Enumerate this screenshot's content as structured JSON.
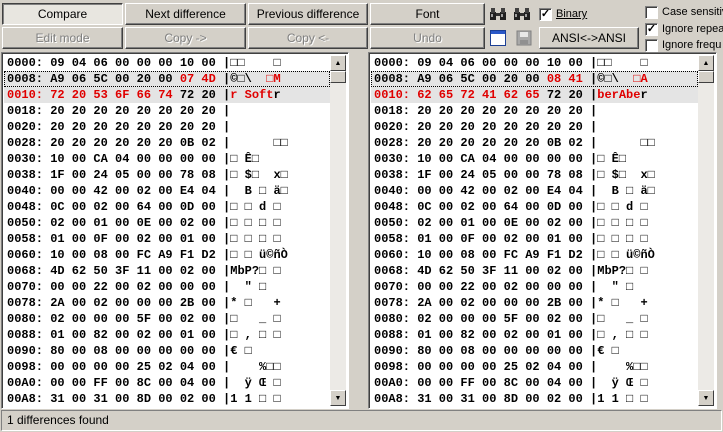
{
  "toolbar": {
    "compare": "Compare",
    "next_difference": "Next difference",
    "previous_difference": "Previous difference",
    "font": "Font",
    "binary": "Binary",
    "binary_checked": true,
    "edit_mode": "Edit mode",
    "copy_right": "Copy ->",
    "copy_left": "Copy <-",
    "undo": "Undo",
    "ansi_ansi": "ANSI<->ANSI",
    "case_sensitive": "Case sensitive",
    "case_sensitive_checked": false,
    "ignore_repeat": "Ignore repeat",
    "ignore_repeat_checked": true,
    "ignore_frequ": "Ignore frequ",
    "ignore_frequ_checked": false
  },
  "left_pane": {
    "rows": [
      [
        "0000: 09 04 06 00 00 00 10 00 |□□    □"
      ],
      [
        "0008: A9 06 5C 00 20 00 ",
        "07 4D",
        " |©□\\  ",
        "□M"
      ],
      [
        "",
        "0010: 72 20 53 6F 66 74",
        " 72 20 |",
        "r Soft",
        "r"
      ],
      [
        "0018: 20 20 20 20 20 20 20 20 |"
      ],
      [
        "0020: 20 20 20 20 20 20 20 20 |"
      ],
      [
        "0028: 20 20 20 20 20 20 0B 02 |      □□"
      ],
      [
        "0030: 10 00 CA 04 00 00 00 00 |□ Ê□"
      ],
      [
        "0038: 1F 00 24 05 00 00 78 08 |□ $□  x□"
      ],
      [
        "0040: 00 00 42 00 02 00 E4 04 |  B □ ä□"
      ],
      [
        "0048: 0C 00 02 00 64 00 0D 00 |□ □ d □"
      ],
      [
        "0050: 02 00 01 00 0E 00 02 00 |□ □ □ □"
      ],
      [
        "0058: 01 00 0F 00 02 00 01 00 |□ □ □ □"
      ],
      [
        "0060: 10 00 08 00 FC A9 F1 D2 |□ □ ü©ñÒ"
      ],
      [
        "0068: 4D 62 50 3F 11 00 02 00 |MbP?□ □"
      ],
      [
        "0070: 00 00 22 00 02 00 00 00 |  \" □"
      ],
      [
        "0078: 2A 00 02 00 00 00 2B 00 |* □   +"
      ],
      [
        "0080: 02 00 00 00 5F 00 02 00 |□   _ □"
      ],
      [
        "0088: 01 00 82 00 02 00 01 00 |□ , □ □"
      ],
      [
        "0090: 80 00 08 00 00 00 00 00 |€ □"
      ],
      [
        "0098: 00 00 00 00 25 02 04 00 |    %□□"
      ],
      [
        "00A0: 00 00 FF 00 8C 00 04 00 |  ÿ Œ □"
      ],
      [
        "00A8: 31 00 31 00 8D 00 02 00 |1 1 □ □"
      ]
    ]
  },
  "right_pane": {
    "rows": [
      [
        "0000: 09 04 06 00 00 00 10 00 |□□    □"
      ],
      [
        "0008: A9 06 5C 00 20 00 ",
        "08 41",
        " |©□\\  ",
        "□A"
      ],
      [
        "",
        "0010: 62 65 72 41 62 65",
        " 72 20 |",
        "berAbe",
        "r"
      ],
      [
        "0018: 20 20 20 20 20 20 20 20 |"
      ],
      [
        "0020: 20 20 20 20 20 20 20 20 |"
      ],
      [
        "0028: 20 20 20 20 20 20 0B 02 |      □□"
      ],
      [
        "0030: 10 00 CA 04 00 00 00 00 |□ Ê□"
      ],
      [
        "0038: 1F 00 24 05 00 00 78 08 |□ $□  x□"
      ],
      [
        "0040: 00 00 42 00 02 00 E4 04 |  B □ ä□"
      ],
      [
        "0048: 0C 00 02 00 64 00 0D 00 |□ □ d □"
      ],
      [
        "0050: 02 00 01 00 0E 00 02 00 |□ □ □ □"
      ],
      [
        "0058: 01 00 0F 00 02 00 01 00 |□ □ □ □"
      ],
      [
        "0060: 10 00 08 00 FC A9 F1 D2 |□ □ ü©ñÒ"
      ],
      [
        "0068: 4D 62 50 3F 11 00 02 00 |MbP?□ □"
      ],
      [
        "0070: 00 00 22 00 02 00 00 00 |  \" □"
      ],
      [
        "0078: 2A 00 02 00 00 00 2B 00 |* □   +"
      ],
      [
        "0080: 02 00 00 00 5F 00 02 00 |□   _ □"
      ],
      [
        "0088: 01 00 82 00 02 00 01 00 |□ , □ □"
      ],
      [
        "0090: 80 00 08 00 00 00 00 00 |€ □"
      ],
      [
        "0098: 00 00 00 00 25 02 04 00 |    %□□"
      ],
      [
        "00A0: 00 00 FF 00 8C 00 04 00 |  ÿ Œ □"
      ],
      [
        "00A8: 31 00 31 00 8D 00 02 00 |1 1 □ □"
      ]
    ]
  },
  "status": {
    "text": "1 differences found"
  },
  "colors": {
    "diff": "#e00000",
    "highlight_row": "#e4e4e4",
    "face": "#d4d0c8"
  }
}
